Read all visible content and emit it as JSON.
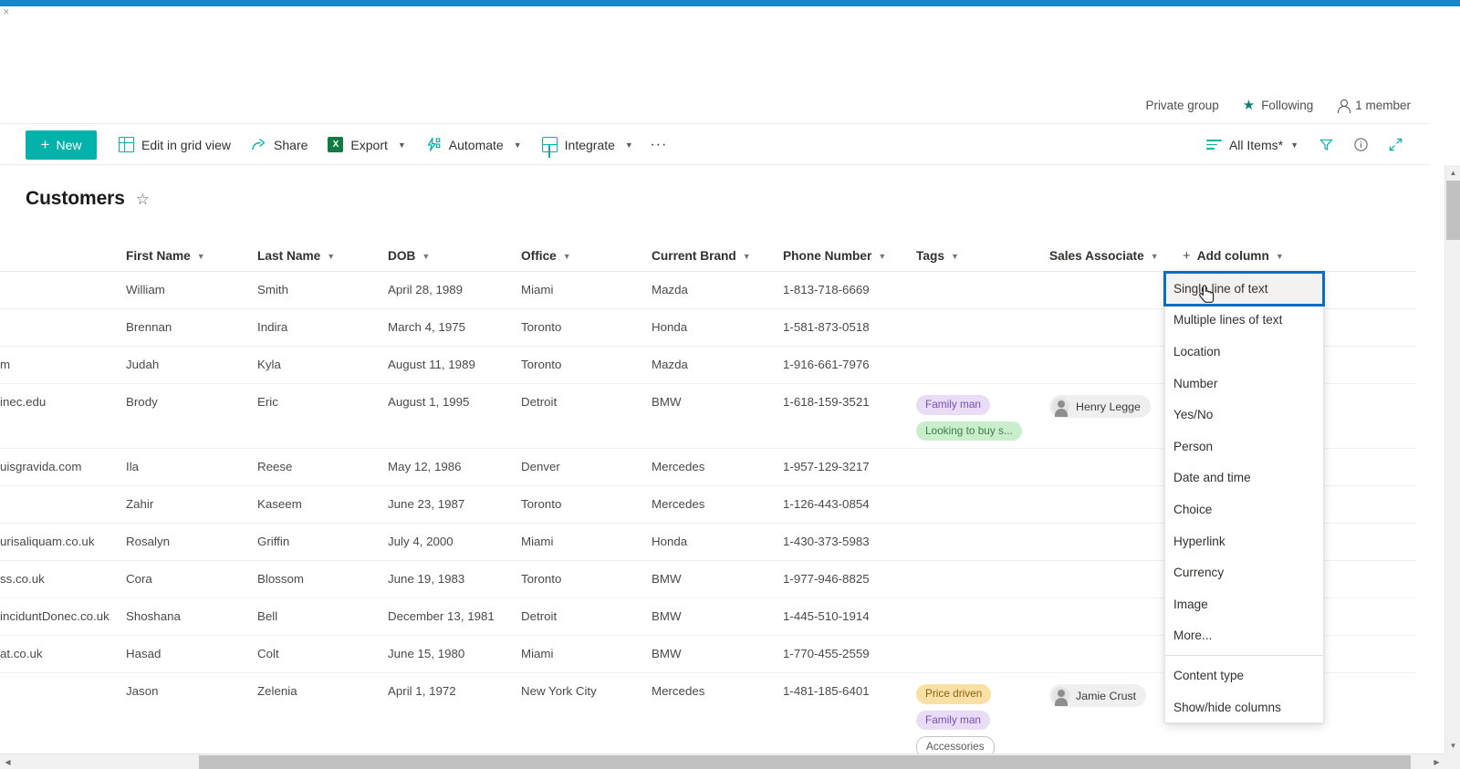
{
  "site_meta": {
    "privacy": "Private group",
    "following": "Following",
    "members": "1 member"
  },
  "command_bar": {
    "new_label": "New",
    "edit_grid_label": "Edit in grid view",
    "share_label": "Share",
    "export_label": "Export",
    "automate_label": "Automate",
    "integrate_label": "Integrate",
    "overflow_label": "···",
    "view_label": "All Items*",
    "excel_glyph": "X"
  },
  "page": {
    "title": "Customers",
    "favorite_glyph": "☆"
  },
  "list": {
    "columns": [
      "First Name",
      "Last Name",
      "DOB",
      "Office",
      "Current Brand",
      "Phone Number",
      "Tags",
      "Sales Associate"
    ],
    "add_column_label": "Add column",
    "rows": [
      {
        "email": "",
        "first": "William",
        "last": "Smith",
        "dob": "April 28, 1989",
        "office": "Miami",
        "brand": "Mazda",
        "phone": "1-813-718-6669",
        "tags": [],
        "associate": ""
      },
      {
        "email": "",
        "first": "Brennan",
        "last": "Indira",
        "dob": "March 4, 1975",
        "office": "Toronto",
        "brand": "Honda",
        "phone": "1-581-873-0518",
        "tags": [],
        "associate": ""
      },
      {
        "email": "m",
        "first": "Judah",
        "last": "Kyla",
        "dob": "August 11, 1989",
        "office": "Toronto",
        "brand": "Mazda",
        "phone": "1-916-661-7976",
        "tags": [],
        "associate": ""
      },
      {
        "email": "inec.edu",
        "first": "Brody",
        "last": "Eric",
        "dob": "August 1, 1995",
        "office": "Detroit",
        "brand": "BMW",
        "phone": "1-618-159-3521",
        "tags": [
          {
            "label": "Family man",
            "color": "purple"
          },
          {
            "label": "Looking to buy s...",
            "color": "green"
          }
        ],
        "associate": "Henry Legge"
      },
      {
        "email": "uisgravida.com",
        "first": "Ila",
        "last": "Reese",
        "dob": "May 12, 1986",
        "office": "Denver",
        "brand": "Mercedes",
        "phone": "1-957-129-3217",
        "tags": [],
        "associate": ""
      },
      {
        "email": "",
        "first": "Zahir",
        "last": "Kaseem",
        "dob": "June 23, 1987",
        "office": "Toronto",
        "brand": "Mercedes",
        "phone": "1-126-443-0854",
        "tags": [],
        "associate": ""
      },
      {
        "email": "urisaliquam.co.uk",
        "first": "Rosalyn",
        "last": "Griffin",
        "dob": "July 4, 2000",
        "office": "Miami",
        "brand": "Honda",
        "phone": "1-430-373-5983",
        "tags": [],
        "associate": ""
      },
      {
        "email": "ss.co.uk",
        "first": "Cora",
        "last": "Blossom",
        "dob": "June 19, 1983",
        "office": "Toronto",
        "brand": "BMW",
        "phone": "1-977-946-8825",
        "tags": [],
        "associate": ""
      },
      {
        "email": "inciduntDonec.co.uk",
        "first": "Shoshana",
        "last": "Bell",
        "dob": "December 13, 1981",
        "office": "Detroit",
        "brand": "BMW",
        "phone": "1-445-510-1914",
        "tags": [],
        "associate": ""
      },
      {
        "email": "at.co.uk",
        "first": "Hasad",
        "last": "Colt",
        "dob": "June 15, 1980",
        "office": "Miami",
        "brand": "BMW",
        "phone": "1-770-455-2559",
        "tags": [],
        "associate": ""
      },
      {
        "email": "",
        "first": "Jason",
        "last": "Zelenia",
        "dob": "April 1, 1972",
        "office": "New York City",
        "brand": "Mercedes",
        "phone": "1-481-185-6401",
        "tags": [
          {
            "label": "Price driven",
            "color": "orange"
          },
          {
            "label": "Family man",
            "color": "purple"
          },
          {
            "label": "Accessories",
            "color": "plain"
          }
        ],
        "associate": "Jamie Crust"
      }
    ]
  },
  "column_type_menu": {
    "items": [
      "Single line of text",
      "Multiple lines of text",
      "Location",
      "Number",
      "Yes/No",
      "Person",
      "Date and time",
      "Choice",
      "Hyperlink",
      "Currency",
      "Image",
      "More..."
    ],
    "footer_items": [
      "Content type",
      "Show/hide columns"
    ],
    "selected": "Single line of text"
  },
  "colors": {
    "accent_teal": "#03b3ab",
    "focus_blue": "#0f6cbd",
    "top_bar_blue": "#1787c9"
  },
  "scroll": {
    "up_glyph": "▲",
    "down_glyph": "▼",
    "left_glyph": "◀",
    "right_glyph": "▶"
  }
}
